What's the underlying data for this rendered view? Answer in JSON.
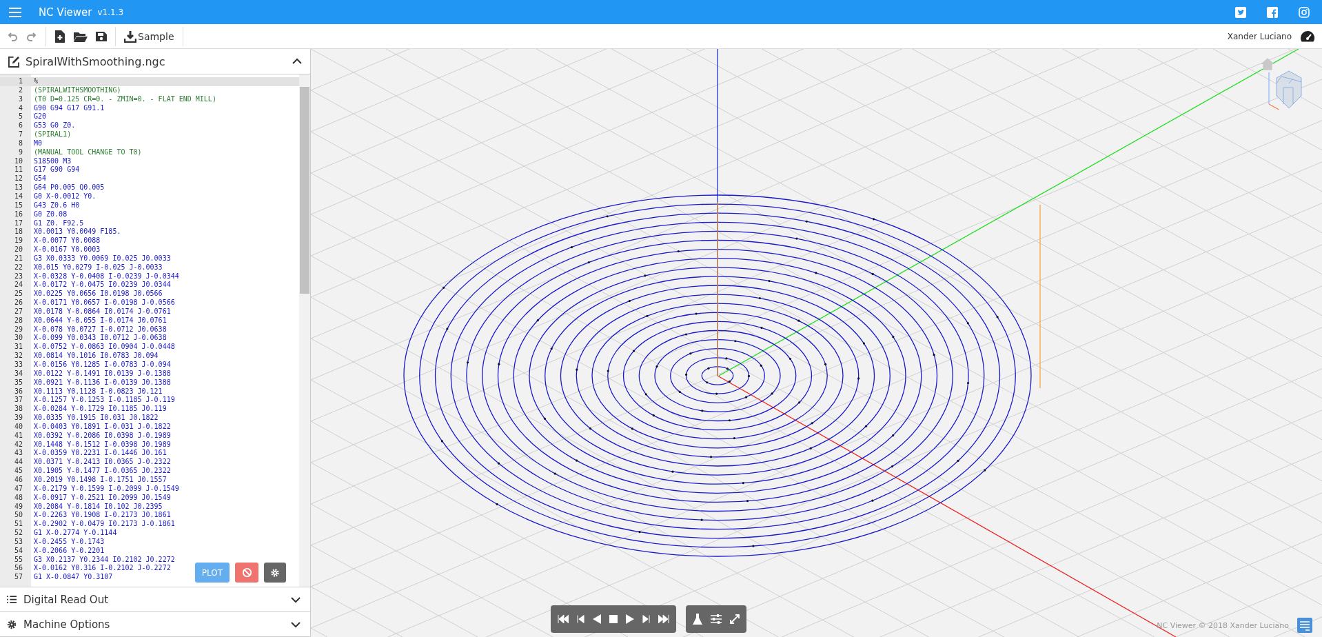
{
  "app": {
    "title": "NC Viewer",
    "version": "v1.1.3"
  },
  "toolbar": {
    "sample_label": "Sample",
    "user": "Xander Luciano"
  },
  "editor": {
    "filename": "SpiralWithSmoothing.ngc",
    "expanded": true,
    "plot_label": "PLOT",
    "lines": [
      {
        "n": "1",
        "text": "%",
        "kind": "plain",
        "active": true
      },
      {
        "n": "2",
        "text": "(SPIRALWITHSMOOTHING)",
        "kind": "comment",
        "active": false
      },
      {
        "n": "3",
        "text": "(T0 D=0.125 CR=0. - ZMIN=0. - FLAT END MILL)",
        "kind": "comment",
        "active": false
      },
      {
        "n": "4",
        "text": "G90 G94 G17 G91.1",
        "kind": "code",
        "active": false
      },
      {
        "n": "5",
        "text": "G20",
        "kind": "code",
        "active": false
      },
      {
        "n": "6",
        "text": "G53 G0 Z0.",
        "kind": "code",
        "active": false
      },
      {
        "n": "7",
        "text": "(SPIRAL1)",
        "kind": "comment",
        "active": false
      },
      {
        "n": "8",
        "text": "M0",
        "kind": "code",
        "active": false
      },
      {
        "n": "9",
        "text": "(MANUAL TOOL CHANGE TO T0)",
        "kind": "comment",
        "active": false
      },
      {
        "n": "10",
        "text": "S18500 M3",
        "kind": "code",
        "active": false
      },
      {
        "n": "11",
        "text": "G17 G90 G94",
        "kind": "code",
        "active": false
      },
      {
        "n": "12",
        "text": "G54",
        "kind": "code",
        "active": false
      },
      {
        "n": "13",
        "text": "G64 P0.005 Q0.005",
        "kind": "code",
        "active": false
      },
      {
        "n": "14",
        "text": "G0 X-0.0012 Y0.",
        "kind": "code",
        "active": false
      },
      {
        "n": "15",
        "text": "G43 Z0.6 H0",
        "kind": "code",
        "active": false
      },
      {
        "n": "16",
        "text": "G0 Z0.08",
        "kind": "code",
        "active": false
      },
      {
        "n": "17",
        "text": "G1 Z0. F92.5",
        "kind": "code",
        "active": false
      },
      {
        "n": "18",
        "text": "X0.0013 Y0.0049 F185.",
        "kind": "code",
        "active": false
      },
      {
        "n": "19",
        "text": "X-0.0077 Y0.0088",
        "kind": "code",
        "active": false
      },
      {
        "n": "20",
        "text": "X-0.0167 Y0.0003",
        "kind": "code",
        "active": false
      },
      {
        "n": "21",
        "text": "G3 X0.0333 Y0.0069 I0.025 J0.0033",
        "kind": "code",
        "active": false
      },
      {
        "n": "22",
        "text": "X0.015 Y0.0279 I-0.025 J-0.0033",
        "kind": "code",
        "active": false
      },
      {
        "n": "23",
        "text": "X-0.0328 Y-0.0408 I-0.0239 J-0.0344",
        "kind": "code",
        "active": false
      },
      {
        "n": "24",
        "text": "X-0.0172 Y-0.0475 I0.0239 J0.0344",
        "kind": "code",
        "active": false
      },
      {
        "n": "25",
        "text": "X0.0225 Y0.0656 I0.0198 J0.0566",
        "kind": "code",
        "active": false
      },
      {
        "n": "26",
        "text": "X-0.0171 Y0.0657 I-0.0198 J-0.0566",
        "kind": "code",
        "active": false
      },
      {
        "n": "27",
        "text": "X0.0178 Y-0.0864 I0.0174 J-0.0761",
        "kind": "code",
        "active": false
      },
      {
        "n": "28",
        "text": "X0.0644 Y-0.055 I-0.0174 J0.0761",
        "kind": "code",
        "active": false
      },
      {
        "n": "29",
        "text": "X-0.078 Y0.0727 I-0.0712 J0.0638",
        "kind": "code",
        "active": false
      },
      {
        "n": "30",
        "text": "X-0.099 Y0.0343 I0.0712 J-0.0638",
        "kind": "code",
        "active": false
      },
      {
        "n": "31",
        "text": "X-0.0752 Y-0.0863 I0.0904 J-0.0448",
        "kind": "code",
        "active": false
      },
      {
        "n": "32",
        "text": "X0.0814 Y0.1016 I0.0783 J0.094",
        "kind": "code",
        "active": false
      },
      {
        "n": "33",
        "text": "X-0.0156 Y0.1285 I-0.0783 J-0.094",
        "kind": "code",
        "active": false
      },
      {
        "n": "34",
        "text": "X0.0122 Y-0.1491 I0.0139 J-0.1388",
        "kind": "code",
        "active": false
      },
      {
        "n": "35",
        "text": "X0.0921 Y-0.1136 I-0.0139 J0.1388",
        "kind": "code",
        "active": false
      },
      {
        "n": "36",
        "text": "X0.1113 Y0.1128 I-0.0823 J0.121",
        "kind": "code",
        "active": false
      },
      {
        "n": "37",
        "text": "X-0.1257 Y-0.1253 I-0.1185 J-0.119",
        "kind": "code",
        "active": false
      },
      {
        "n": "38",
        "text": "X-0.0284 Y-0.1729 I0.1185 J0.119",
        "kind": "code",
        "active": false
      },
      {
        "n": "39",
        "text": "X0.0335 Y0.1915 I0.031 J0.1822",
        "kind": "code",
        "active": false
      },
      {
        "n": "40",
        "text": "X-0.0403 Y0.1891 I-0.031 J-0.1822",
        "kind": "code",
        "active": false
      },
      {
        "n": "41",
        "text": "X0.0392 Y-0.2086 I0.0398 J-0.1989",
        "kind": "code",
        "active": false
      },
      {
        "n": "42",
        "text": "X0.1448 Y-0.1512 I-0.0398 J0.1989",
        "kind": "code",
        "active": false
      },
      {
        "n": "43",
        "text": "X-0.0359 Y0.2231 I-0.1446 J0.161",
        "kind": "code",
        "active": false
      },
      {
        "n": "44",
        "text": "X0.0371 Y-0.2413 I0.0365 J-0.2322",
        "kind": "code",
        "active": false
      },
      {
        "n": "45",
        "text": "X0.1905 Y-0.1477 I-0.0365 J0.2322",
        "kind": "code",
        "active": false
      },
      {
        "n": "46",
        "text": "X0.2019 Y0.1498 I-0.1751 J0.1557",
        "kind": "code",
        "active": false
      },
      {
        "n": "47",
        "text": "X-0.2179 Y-0.1599 I-0.2099 J-0.1549",
        "kind": "code",
        "active": false
      },
      {
        "n": "48",
        "text": "X-0.0917 Y-0.2521 I0.2099 J0.1549",
        "kind": "code",
        "active": false
      },
      {
        "n": "49",
        "text": "X0.2084 Y-0.1814 I0.102 J0.2395",
        "kind": "code",
        "active": false
      },
      {
        "n": "50",
        "text": "X-0.2263 Y0.1908 I-0.2173 J0.1861",
        "kind": "code",
        "active": false
      },
      {
        "n": "51",
        "text": "X-0.2902 Y-0.0479 I0.2173 J-0.1861",
        "kind": "code",
        "active": false
      },
      {
        "n": "52",
        "text": "G1 X-0.2774 Y-0.1144",
        "kind": "code",
        "active": false
      },
      {
        "n": "53",
        "text": "X-0.2455 Y-0.1743",
        "kind": "code",
        "active": false
      },
      {
        "n": "54",
        "text": "X-0.2066 Y-0.2201",
        "kind": "code",
        "active": false
      },
      {
        "n": "55",
        "text": "G3 X0.2137 Y0.2344 I0.2102 J0.2272",
        "kind": "code",
        "active": false
      },
      {
        "n": "56",
        "text": "X-0.0162 Y0.316 I-0.2102 J-0.2272",
        "kind": "code",
        "active": false
      },
      {
        "n": "57",
        "text": "G1 X-0.0847 Y0.3107",
        "kind": "code",
        "active": false
      }
    ]
  },
  "panels": [
    {
      "label": "Digital Read Out",
      "kind": "list",
      "expanded": false
    },
    {
      "label": "Machine Options",
      "kind": "gear",
      "expanded": false
    }
  ],
  "footer": "NC Viewer © 2018 Xander Luciano"
}
